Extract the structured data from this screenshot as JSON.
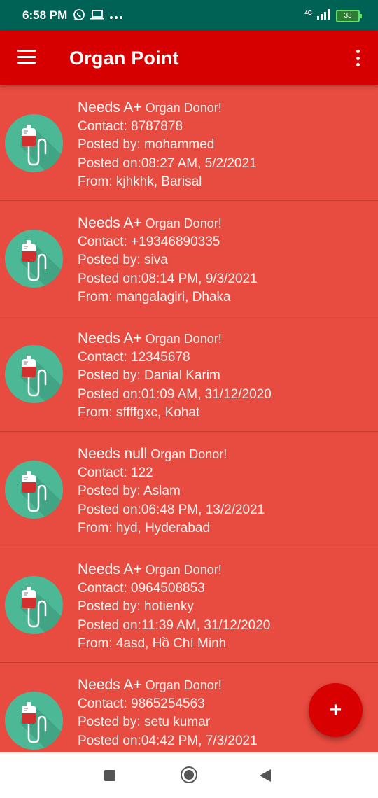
{
  "status_bar": {
    "time": "6:58 PM",
    "network": "4G",
    "battery": "33",
    "left_icons": [
      "whatsapp-icon",
      "laptop-icon",
      "more-notifications-icon"
    ],
    "right_icons": [
      "signal-icon",
      "battery-icon"
    ]
  },
  "app_bar": {
    "title": "Organ Point",
    "background": "#d60000",
    "menu_icon": "hamburger-menu-icon",
    "more_icon": "more-vertical-icon"
  },
  "list": {
    "background": "#e84b3f",
    "avatar_color": "#4db896",
    "avatar_icon": "blood-bag-icon",
    "items": [
      {
        "needs": "Needs A+",
        "suffix": " Organ Donor!",
        "contact": "Contact: 8787878",
        "posted_by": "Posted by: mohammed",
        "posted_on": "Posted on:08:27 AM, 5/2/2021",
        "from": "From: kjhkhk, Barisal"
      },
      {
        "needs": "Needs A+",
        "suffix": " Organ Donor!",
        "contact": "Contact: +19346890335",
        "posted_by": "Posted by: siva",
        "posted_on": "Posted on:08:14 PM, 9/3/2021",
        "from": "From: mangalagiri, Dhaka"
      },
      {
        "needs": "Needs A+",
        "suffix": " Organ Donor!",
        "contact": "Contact: 12345678",
        "posted_by": "Posted by: Danial Karim",
        "posted_on": "Posted on:01:09 AM, 31/12/2020",
        "from": "From: sffffgxc, Kohat"
      },
      {
        "needs": "Needs null",
        "suffix": " Organ Donor!",
        "contact": "Contact: 122",
        "posted_by": "Posted by:  Aslam",
        "posted_on": "Posted on:06:48 PM, 13/2/2021",
        "from": "From: hyd, Hyderabad"
      },
      {
        "needs": "Needs A+",
        "suffix": " Organ Donor!",
        "contact": "Contact: 0964508853",
        "posted_by": "Posted by: hotienky",
        "posted_on": "Posted on:11:39 AM, 31/12/2020",
        "from": "From: 4asd, Hồ Chí Minh"
      },
      {
        "needs": "Needs A+",
        "suffix": " Organ Donor!",
        "contact": "Contact: 9865254563",
        "posted_by": "Posted by: setu kumar",
        "posted_on": "Posted on:04:42 PM, 7/3/2021",
        "from": ""
      }
    ]
  },
  "fab": {
    "label": "+",
    "color": "#d80000",
    "icon": "add-icon"
  },
  "nav_bar": {
    "icons": [
      "recents-icon",
      "home-icon",
      "back-icon"
    ]
  }
}
